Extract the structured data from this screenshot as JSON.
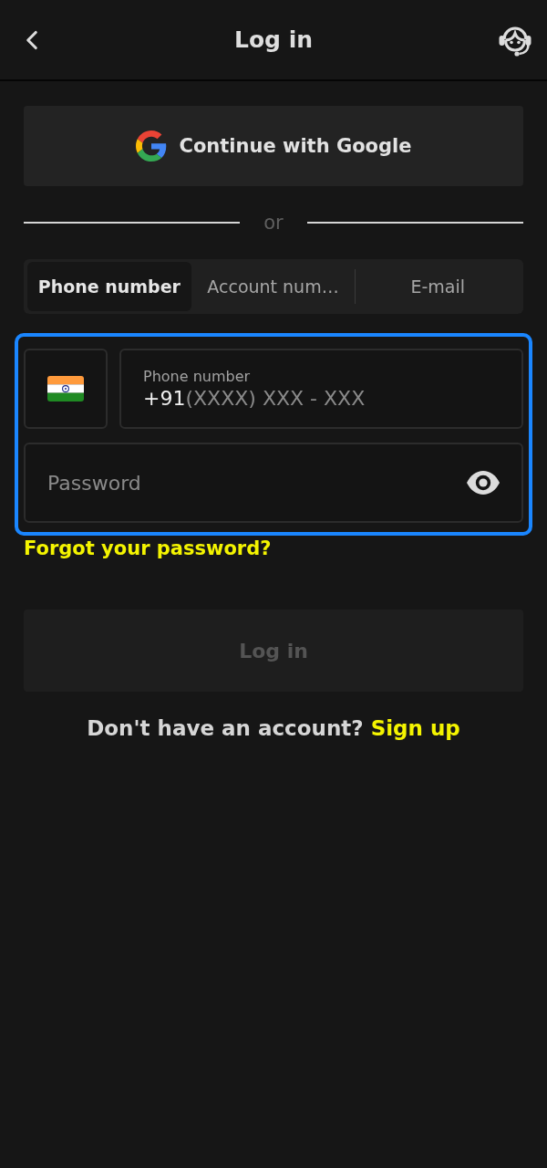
{
  "header": {
    "title": "Log in"
  },
  "google_button": {
    "label": "Continue with Google"
  },
  "divider": {
    "label": "or"
  },
  "tabs": [
    {
      "label": "Phone number",
      "selected": true
    },
    {
      "label": "Account num…",
      "selected": false
    },
    {
      "label": "E-mail",
      "selected": false
    }
  ],
  "form_focused": true,
  "phone_field": {
    "label": "Phone number",
    "prefix": "+91",
    "placeholder": "(XXXX) XXX - XXX"
  },
  "password_field": {
    "placeholder": "Password"
  },
  "forgot_link": "Forgot your password?",
  "login_button": {
    "label": "Log in",
    "disabled": true
  },
  "signup_prompt": {
    "text": "Don't have an account?",
    "link": "Sign up"
  }
}
